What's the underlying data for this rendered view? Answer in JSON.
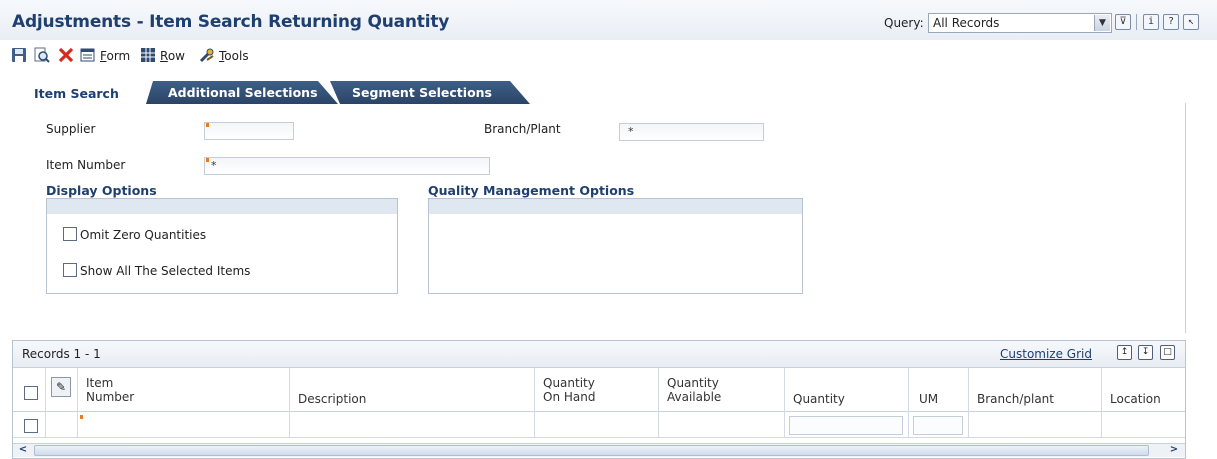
{
  "header": {
    "title": "Adjustments - Item Search Returning Quantity",
    "query_label": "Query:",
    "query_value": "All Records"
  },
  "toolbar": {
    "form_label_u": "F",
    "form_label_rest": "orm",
    "row_label_u": "R",
    "row_label_rest": "ow",
    "tools_label_u": "T",
    "tools_label_rest": "ools"
  },
  "tabs": [
    {
      "label": "Item Search",
      "active": true
    },
    {
      "label": "Additional Selections",
      "active": false
    },
    {
      "label": "Segment Selections",
      "active": false
    }
  ],
  "form": {
    "supplier_label": "Supplier",
    "supplier_value": "",
    "branch_label": "Branch/Plant",
    "branch_value": "*",
    "item_number_label": "Item Number",
    "item_number_value": "*",
    "display_options_title": "Display Options",
    "omit_zero_label": "Omit Zero Quantities",
    "omit_zero_checked": false,
    "show_all_label": "Show All The Selected Items",
    "show_all_checked": false,
    "qm_options_title": "Quality Management Options"
  },
  "grid": {
    "records_text": "Records 1 - 1",
    "customize_label": "Customize Grid",
    "columns": [
      {
        "line1": "Item",
        "line2": "Number"
      },
      {
        "line1": "",
        "line2": "Description"
      },
      {
        "line1": "Quantity",
        "line2": "On Hand"
      },
      {
        "line1": "Quantity",
        "line2": "Available"
      },
      {
        "line1": "",
        "line2": "Quantity"
      },
      {
        "line1": "",
        "line2": "UM"
      },
      {
        "line1": "",
        "line2": "Branch/plant"
      },
      {
        "line1": "",
        "line2": "Location"
      }
    ]
  },
  "colors": {
    "title": "#1f3f6f",
    "tab_dark": "#2f4b72",
    "required_marker": "#ee7a1a"
  }
}
